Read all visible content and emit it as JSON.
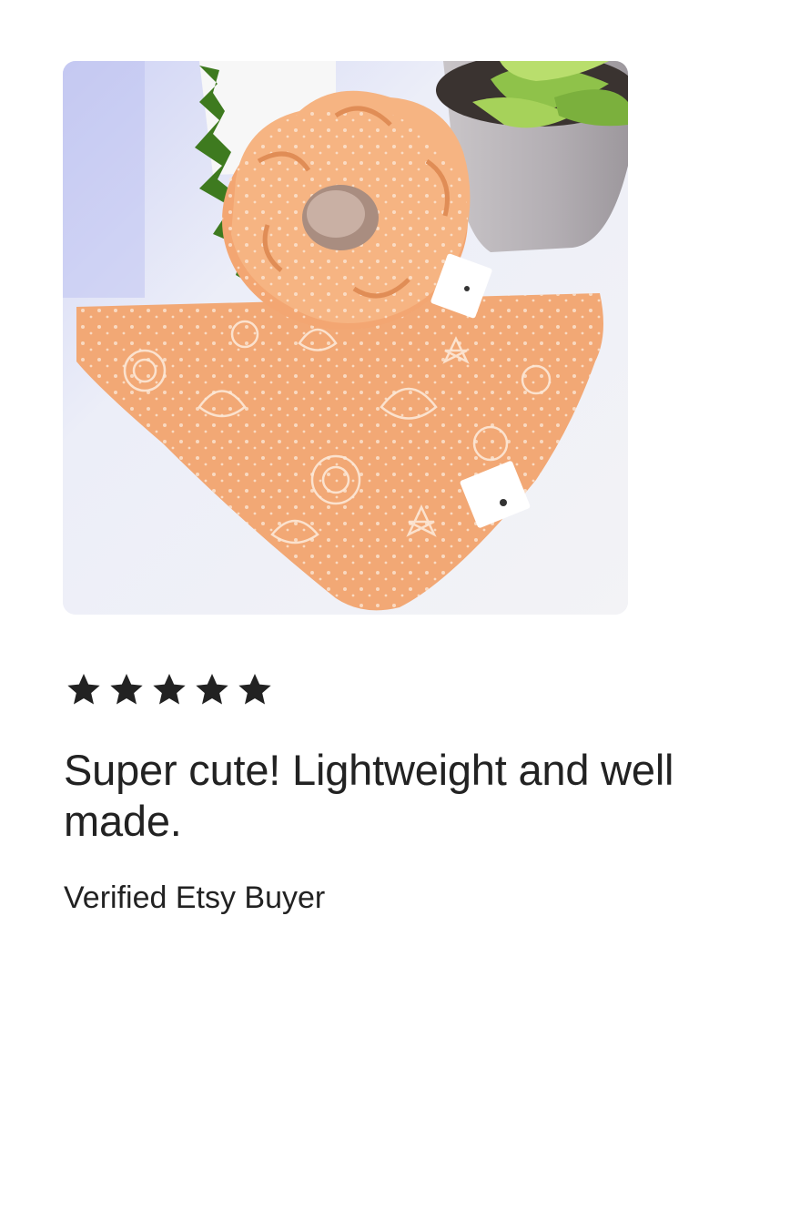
{
  "review": {
    "rating": 5,
    "rating_max": 5,
    "star_color": "#222222",
    "headline": "Super cute! Lightweight and well made.",
    "reviewer": "Verified Etsy Buyer",
    "photo_description_icon": "product-photo"
  }
}
